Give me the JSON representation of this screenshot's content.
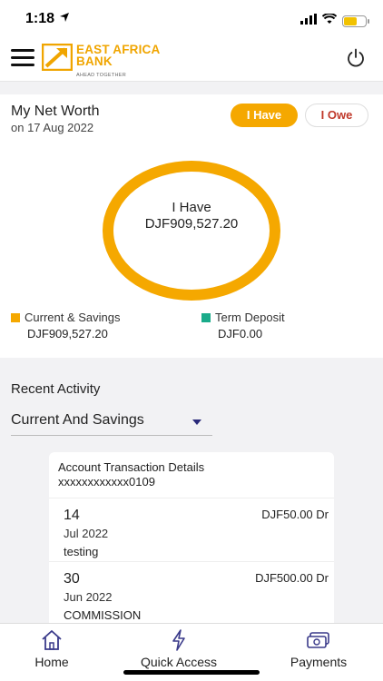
{
  "status_bar": {
    "time": "1:18",
    "battery_level": 0.6
  },
  "header": {
    "brand_line1": "EAST AFRICA",
    "brand_line2": "BANK",
    "tagline": "AHEAD TOGETHER",
    "brand_color": "#f0a500"
  },
  "net_worth": {
    "title": "My Net Worth",
    "date": "on 17 Aug 2022",
    "toggle_have": "I Have",
    "toggle_owe": "I Owe",
    "donut_label": "I Have",
    "donut_value": "DJF909,527.20",
    "legend": [
      {
        "label": "Current & Savings",
        "value": "DJF909,527.20",
        "color": "#f5a800"
      },
      {
        "label": "Term Deposit",
        "value": "DJF0.00",
        "color": "#1aab8a"
      }
    ]
  },
  "recent_activity": {
    "title": "Recent Activity",
    "selected_account_type": "Current And Savings",
    "details_title": "Account Transaction Details",
    "account_number": "xxxxxxxxxxxx0109",
    "transactions": [
      {
        "day": "14",
        "month": "Jul 2022",
        "description": "testing",
        "amount": "DJF50.00 Dr"
      },
      {
        "day": "30",
        "month": "Jun 2022",
        "description": "COMMISSION",
        "amount": "DJF500.00 Dr"
      }
    ]
  },
  "bottom_nav": {
    "home": "Home",
    "quick_access": "Quick Access",
    "payments": "Payments"
  }
}
